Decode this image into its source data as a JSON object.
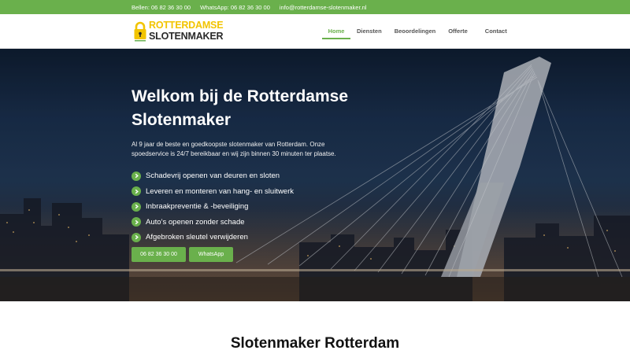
{
  "topbar": {
    "phone": "Bellen: 06 82 36 30 00",
    "whatsapp": "WhatsApp: 06 82 36 30 00",
    "email": "info@rotterdamse-slotenmaker.nl"
  },
  "logo": {
    "line1": "Rotterdamse",
    "line2": "Slotenmaker",
    "icon": "padlock-icon"
  },
  "nav": {
    "items": [
      {
        "label": "Home",
        "active": true
      },
      {
        "label": "Diensten"
      },
      {
        "label": "Beoordelingen"
      },
      {
        "label": "Offerte"
      },
      {
        "label": "Contact"
      }
    ]
  },
  "hero": {
    "title": "Welkom bij de Rotterdamse Slotenmaker",
    "text": "Al 9 jaar de beste en goedkoopste slotenmaker van Rotterdam. Onze spoedservice is 24/7 bereikbaar en wij zijn binnen 30 minuten ter plaatse.",
    "features": [
      "Schadevrij openen van deuren en sloten",
      "Leveren en monteren van hang- en sluitwerk",
      "Inbraakpreventie & -beveiliging",
      "Auto’s openen zonder schade",
      "Afgebroken sleutel verwijderen"
    ],
    "phone_button": "06 82 36 30 00",
    "whatsapp_button": "WhatsApp"
  },
  "section": {
    "title": "Slotenmaker Rotterdam"
  },
  "colors": {
    "accent": "#6ab04c",
    "logo_yellow": "#f2c400"
  }
}
